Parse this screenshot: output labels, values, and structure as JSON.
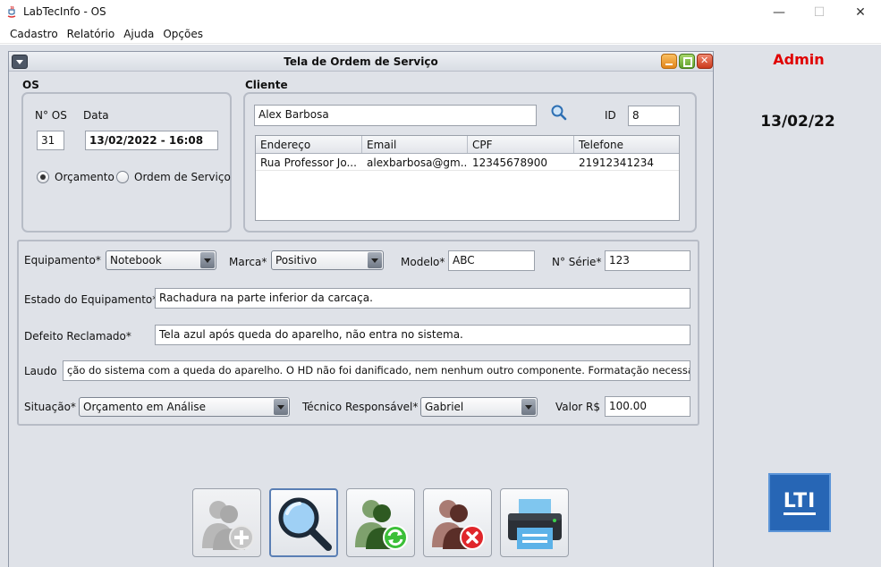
{
  "window": {
    "title": "LabTecInfo - OS",
    "min": "—",
    "max": "☐",
    "close": "✕"
  },
  "menu": [
    "Cadastro",
    "Relatório",
    "Ajuda",
    "Opções"
  ],
  "sidebar": {
    "user": "Admin",
    "date": "13/02/22",
    "logo": "LTI"
  },
  "frame": {
    "title": "Tela de Ordem de Serviço",
    "os": {
      "section": "OS",
      "num_label": "N° OS",
      "date_label": "Data",
      "num_value": "31",
      "date_value": "13/02/2022 - 16:08",
      "radio_orcamento": "Orçamento",
      "radio_ordem": "Ordem de Serviço",
      "selected": "Orçamento"
    },
    "cliente": {
      "section": "Cliente",
      "search_value": "Alex Barbosa",
      "id_label": "ID",
      "id_value": "8",
      "columns": [
        "Endereço",
        "Email",
        "CPF",
        "Telefone"
      ],
      "rows": [
        [
          "Rua Professor Jo...",
          "alexbarbosa@gm...",
          "12345678900",
          "21912341234"
        ]
      ]
    },
    "equip": {
      "equipamento_label": "Equipamento*",
      "equipamento_value": "Notebook",
      "marca_label": "Marca*",
      "marca_value": "Positivo",
      "modelo_label": "Modelo*",
      "modelo_value": "ABC",
      "serie_label": "N° Série*",
      "serie_value": "123",
      "estado_label": "Estado do Equipamento*",
      "estado_value": "Rachadura na parte inferior da carcaça.",
      "defeito_label": "Defeito Reclamado*",
      "defeito_value": "Tela azul após queda do aparelho, não entra no sistema.",
      "laudo_label": "Laudo",
      "laudo_value": "ção do sistema com a queda do aparelho. O HD não foi danificado, nem nenhum outro componente. Formatação necessária.",
      "situacao_label": "Situação*",
      "situacao_value": "Orçamento em Análise",
      "tecnico_label": "Técnico Responsável*",
      "tecnico_value": "Gabriel",
      "valor_label": "Valor R$",
      "valor_value": "100.00"
    }
  },
  "colors": {
    "admin": "#e00000",
    "desktop": "#dfe2e8",
    "logo": "#2766b5"
  }
}
